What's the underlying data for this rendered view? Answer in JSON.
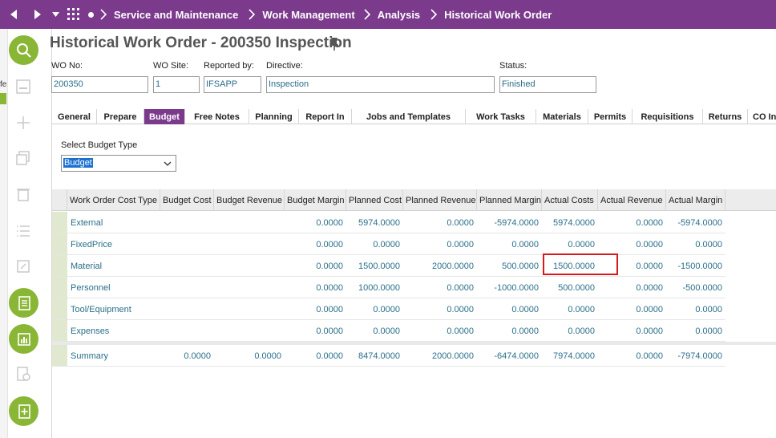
{
  "nav": {
    "breadcrumbs": [
      "Service and Maintenance",
      "Work Management",
      "Analysis",
      "Historical Work Order"
    ]
  },
  "sidebar": {
    "stub_text": "fe"
  },
  "page": {
    "title": "Historical Work Order - 200350 Inspection"
  },
  "fields": {
    "wo_no": {
      "label": "WO No:",
      "value": "200350"
    },
    "wo_site": {
      "label": "WO Site:",
      "value": "1"
    },
    "reported_by": {
      "label": "Reported by:",
      "value": "IFSAPP"
    },
    "directive": {
      "label": "Directive:",
      "value": "Inspection"
    },
    "status": {
      "label": "Status:",
      "value": "Finished"
    }
  },
  "tabs": [
    {
      "label": "General"
    },
    {
      "label": "Prepare"
    },
    {
      "label": "Budget",
      "active": true
    },
    {
      "label": "Free Notes"
    },
    {
      "label": "Planning"
    },
    {
      "label": "Report In"
    },
    {
      "label": "Jobs and Templates"
    },
    {
      "label": "Work Tasks"
    },
    {
      "label": "Materials"
    },
    {
      "label": "Permits"
    },
    {
      "label": "Requisitions"
    },
    {
      "label": "Returns"
    },
    {
      "label": "CO In"
    }
  ],
  "budget_type": {
    "label": "Select Budget Type",
    "value": "Budget"
  },
  "grid": {
    "columns": [
      "Work Order Cost Type",
      "Budget Cost",
      "Budget Revenue",
      "Budget Margin",
      "Planned Cost",
      "Planned Revenue",
      "Planned Margin",
      "Actual Costs",
      "Actual Revenue",
      "Actual Margin"
    ],
    "rows": [
      [
        "External",
        "",
        "",
        "0.0000",
        "5974.0000",
        "0.0000",
        "-5974.0000",
        "5974.0000",
        "0.0000",
        "-5974.0000"
      ],
      [
        "FixedPrice",
        "",
        "",
        "0.0000",
        "0.0000",
        "0.0000",
        "0.0000",
        "0.0000",
        "0.0000",
        "0.0000"
      ],
      [
        "Material",
        "",
        "",
        "0.0000",
        "1500.0000",
        "2000.0000",
        "500.0000",
        "1500.0000",
        "0.0000",
        "-1500.0000"
      ],
      [
        "Personnel",
        "",
        "",
        "0.0000",
        "1000.0000",
        "0.0000",
        "-1000.0000",
        "500.0000",
        "0.0000",
        "-500.0000"
      ],
      [
        "Tool/Equipment",
        "",
        "",
        "0.0000",
        "0.0000",
        "0.0000",
        "0.0000",
        "0.0000",
        "0.0000",
        "0.0000"
      ],
      [
        "Expenses",
        "",
        "",
        "0.0000",
        "0.0000",
        "0.0000",
        "0.0000",
        "0.0000",
        "0.0000",
        "0.0000"
      ]
    ],
    "summary": [
      "Summary",
      "0.0000",
      "0.0000",
      "0.0000",
      "8474.0000",
      "2000.0000",
      "-6474.0000",
      "7974.0000",
      "0.0000",
      "-7974.0000"
    ]
  },
  "colors": {
    "brand": "#7b3a8c",
    "action_green": "#8ab635",
    "value_text": "#2a6f8a",
    "highlight": "#d61a1a"
  }
}
